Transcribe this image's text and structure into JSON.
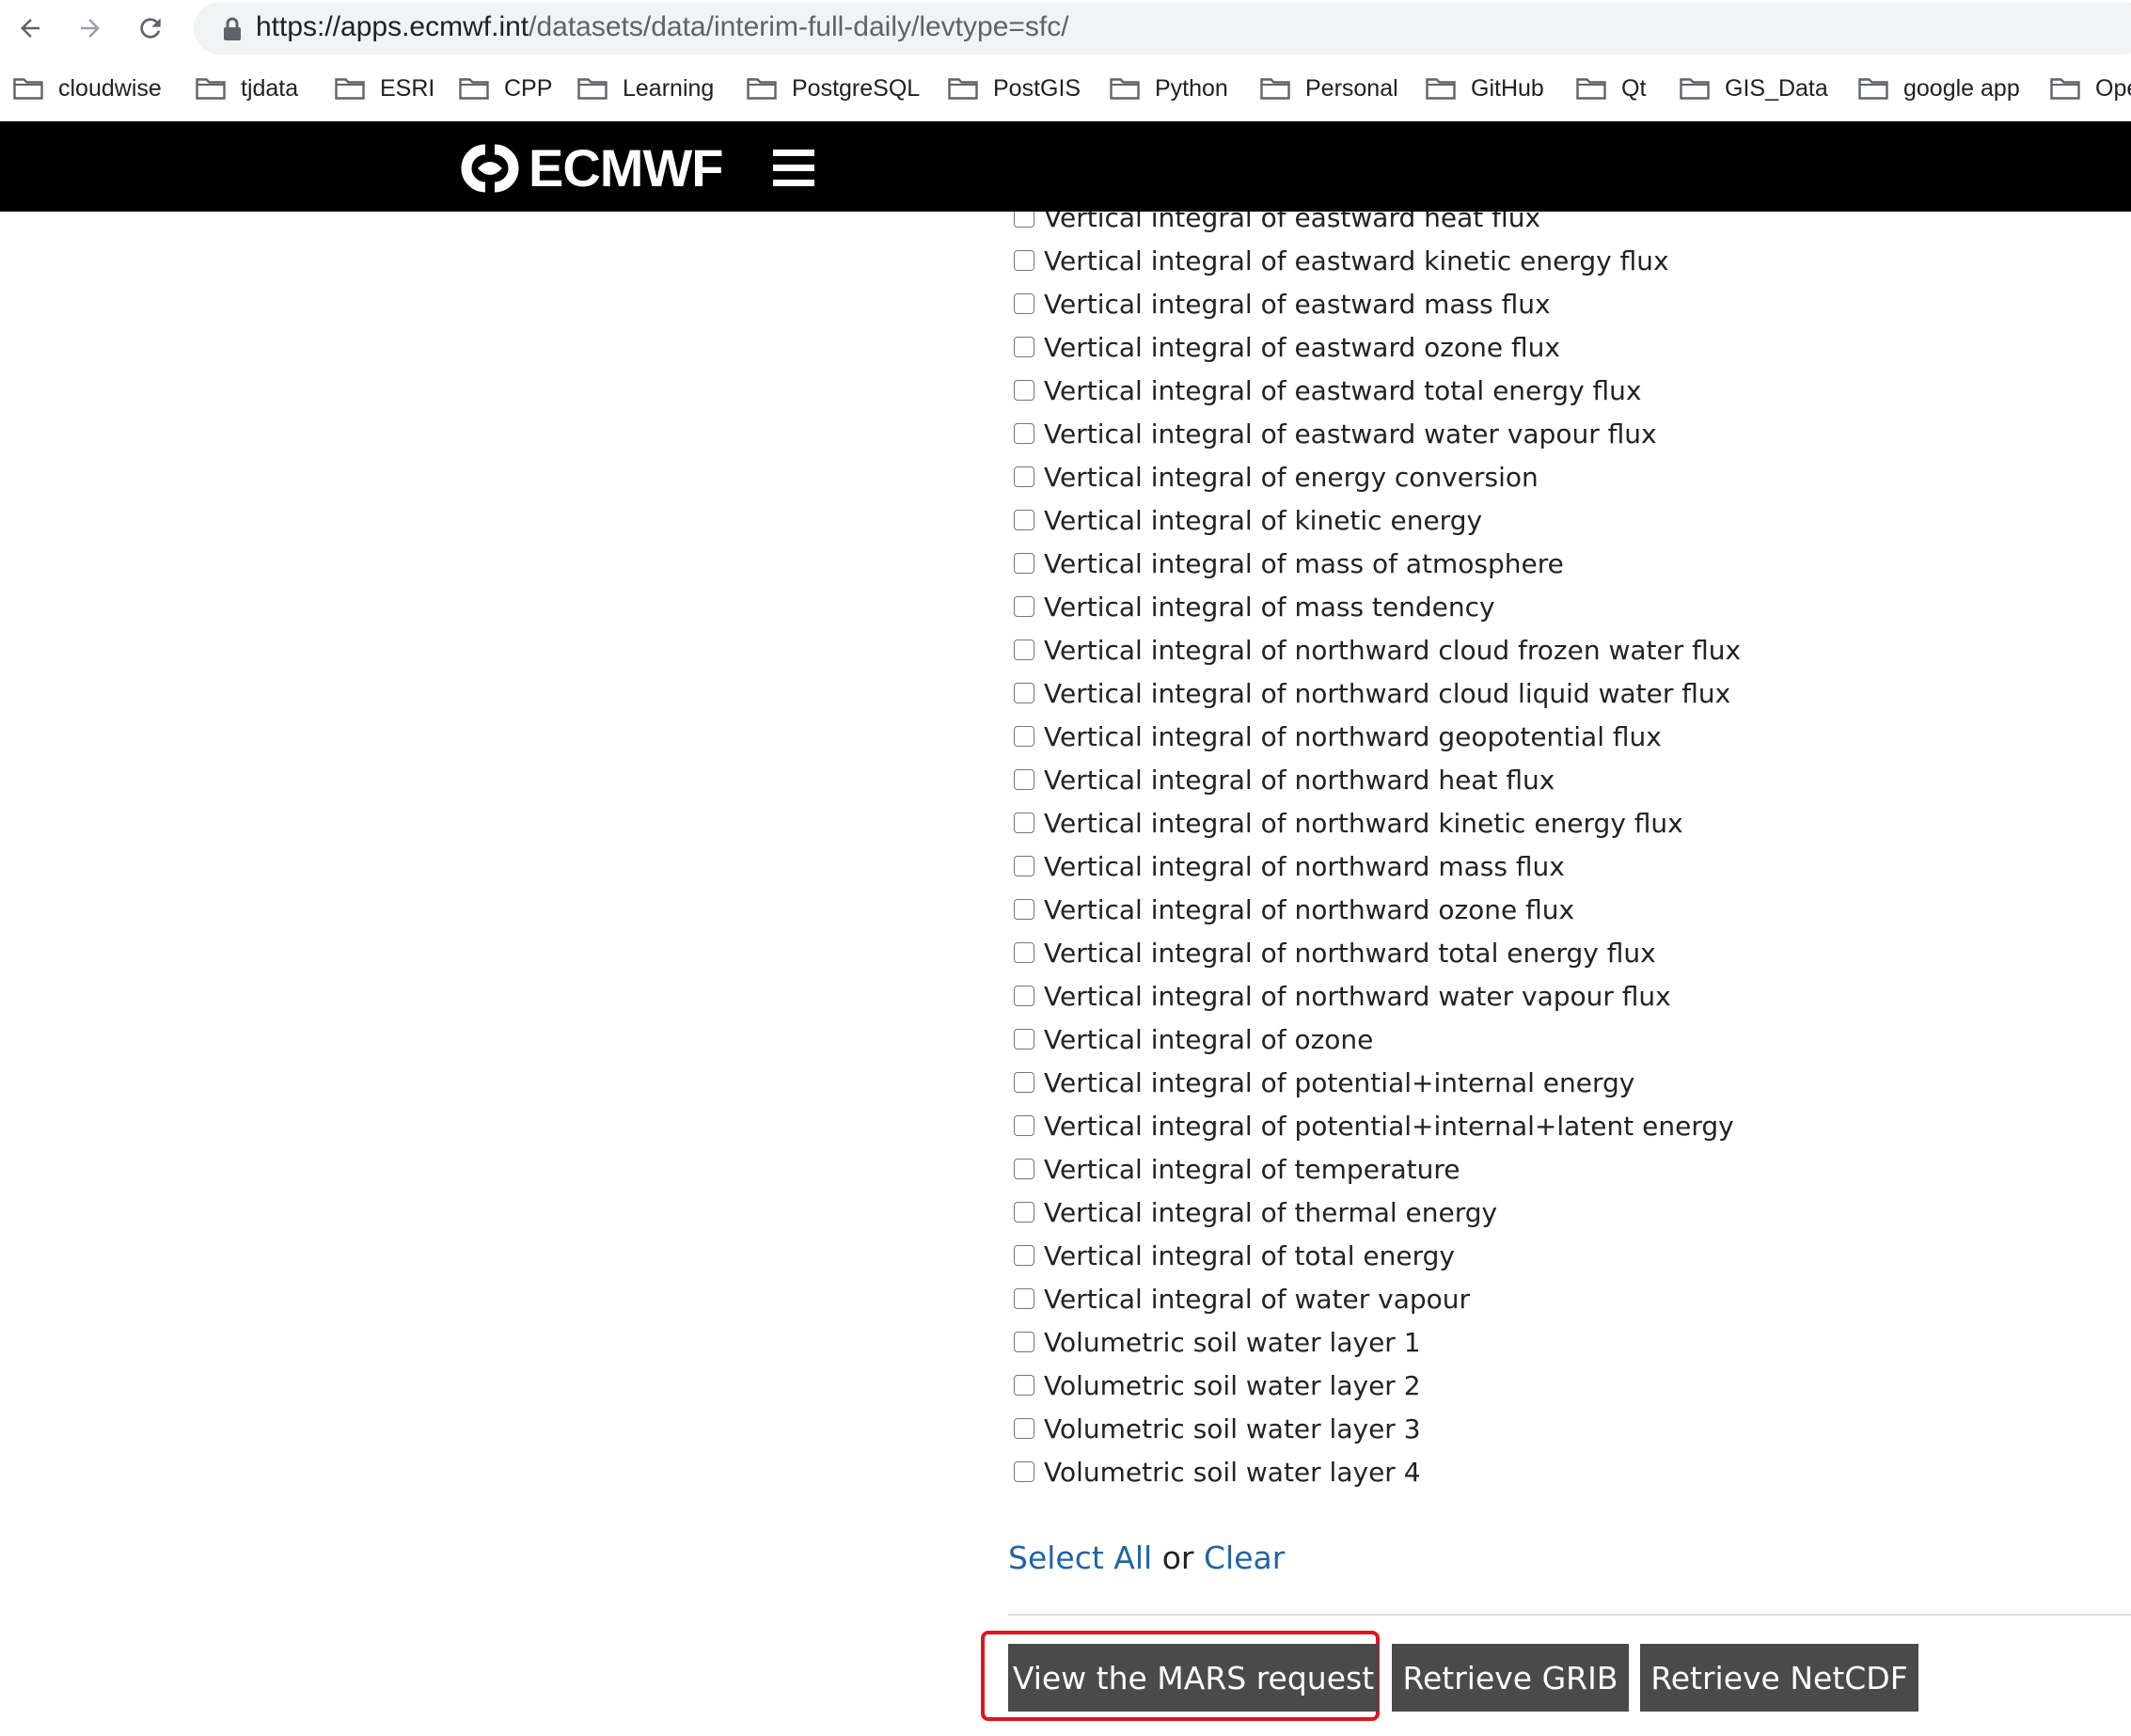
{
  "browser": {
    "url_host": "https://apps.ecmwf.int",
    "url_path": "/datasets/data/interim-full-daily/levtype=sfc/",
    "bookmarks": [
      "cloudwise",
      "tjdata",
      "ESRI",
      "CPP",
      "Learning",
      "PostgreSQL",
      "PostGIS",
      "Python",
      "Personal",
      "GitHub",
      "Qt",
      "GIS_Data",
      "google app",
      "Ope"
    ]
  },
  "header": {
    "logo_text": "ECMWF"
  },
  "parameters": [
    "Vertical integral of eastward heat flux",
    "Vertical integral of eastward kinetic energy flux",
    "Vertical integral of eastward mass flux",
    "Vertical integral of eastward ozone flux",
    "Vertical integral of eastward total energy flux",
    "Vertical integral of eastward water vapour flux",
    "Vertical integral of energy conversion",
    "Vertical integral of kinetic energy",
    "Vertical integral of mass of atmosphere",
    "Vertical integral of mass tendency",
    "Vertical integral of northward cloud frozen water flux",
    "Vertical integral of northward cloud liquid water flux",
    "Vertical integral of northward geopotential flux",
    "Vertical integral of northward heat flux",
    "Vertical integral of northward kinetic energy flux",
    "Vertical integral of northward mass flux",
    "Vertical integral of northward ozone flux",
    "Vertical integral of northward total energy flux",
    "Vertical integral of northward water vapour flux",
    "Vertical integral of ozone",
    "Vertical integral of potential+internal energy",
    "Vertical integral of potential+internal+latent energy",
    "Vertical integral of temperature",
    "Vertical integral of thermal energy",
    "Vertical integral of total energy",
    "Vertical integral of water vapour",
    "Volumetric soil water layer 1",
    "Volumetric soil water layer 2",
    "Volumetric soil water layer 3",
    "Volumetric soil water layer 4"
  ],
  "selection": {
    "select_all": "Select All",
    "or": "or",
    "clear": "Clear"
  },
  "actions": {
    "view_mars": "View the MARS request",
    "retrieve_grib": "Retrieve GRIB",
    "retrieve_netcdf": "Retrieve NetCDF"
  },
  "colors": {
    "link": "#1f64a8",
    "button_bg": "#4a4a4a",
    "highlight": "#e0141e",
    "header_bg": "#000000"
  }
}
